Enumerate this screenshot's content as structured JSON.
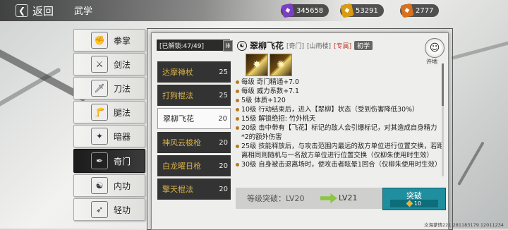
{
  "header": {
    "back_label": "返回",
    "page_title": "武学",
    "currencies": [
      {
        "icon": "purple-jade-icon",
        "value": "345658",
        "color": "#7a3fc4"
      },
      {
        "icon": "gold-ingot-icon",
        "value": "53291",
        "color": "#d89b12"
      },
      {
        "icon": "orange-token-icon",
        "value": "2777",
        "color": "#d8701e"
      }
    ]
  },
  "categories": [
    {
      "label": "拳掌",
      "icon": "fist-icon",
      "glyph": "✊"
    },
    {
      "label": "剑法",
      "icon": "sword-icon",
      "glyph": "⚔"
    },
    {
      "label": "刀法",
      "icon": "blade-icon",
      "glyph": "🗡"
    },
    {
      "label": "腿法",
      "icon": "kick-icon",
      "glyph": "🦵"
    },
    {
      "label": "暗器",
      "icon": "dart-icon",
      "glyph": "✦"
    },
    {
      "label": "奇门",
      "icon": "odd-weapon-icon",
      "glyph": "✒"
    },
    {
      "label": "内功",
      "icon": "inner-power-icon",
      "glyph": "☯"
    },
    {
      "label": "轻功",
      "icon": "light-foot-icon",
      "glyph": "➶"
    }
  ],
  "active_category": "奇门",
  "skill_list": {
    "header": "[已解锁:47/49]",
    "sort_label": "排",
    "items": [
      {
        "name": "达摩禅杖",
        "level": "25"
      },
      {
        "name": "打狗棍法",
        "level": "25"
      },
      {
        "name": "翠柳飞花",
        "level": "20"
      },
      {
        "name": "神风云梭枪",
        "level": "20"
      },
      {
        "name": "白龙曜日枪",
        "level": "20"
      },
      {
        "name": "擎天棍法",
        "level": "20"
      }
    ],
    "selected": "翠柳飞花"
  },
  "detail": {
    "title": "翠柳飞花",
    "tag_type": "[奇门]",
    "tag_school": "[山雨楼]",
    "tag_exclusive": "[专属]",
    "tag_stage": "初学",
    "portrait_label": "许地",
    "effects": [
      "每级  奇门精通+7.0",
      "每级  威力系数+7.1",
      "5级  体质+120",
      "10级  行动结束后，进入【翠柳】状态（受到伤害降低30%）",
      "15级  解锁绝招:    竹外桃夭",
      "20级  击中带有【飞花】标记的敌人会引爆标记，对其造成自身精力*2的额外伤害",
      "25级  技能释放后，与攻击范围内最远的敌方单位进行位置交换，若距离相同则随机与一名敌方单位进行位置交换（仅柳朱使用时生效）",
      "30级  自身被击退离场时，使攻击者眩晕1回合（仅柳朱使用时生效）"
    ]
  },
  "breakthrough": {
    "label": "等级突破：LV20",
    "target": "LV21",
    "button_label": "突破",
    "cost": "10"
  },
  "footer": "文海蒙情221 281183179 12011234"
}
